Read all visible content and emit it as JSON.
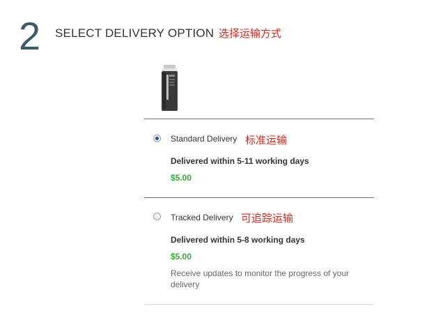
{
  "step": {
    "number": "2",
    "title": "SELECT DELIVERY OPTION",
    "title_annotation": "选择运输方式"
  },
  "product": {
    "icon": "exfoliant-bottle-image"
  },
  "options": [
    {
      "label": "Standard Delivery",
      "annotation": "标准运输",
      "description": "Delivered within 5-11 working days",
      "price": "$5.00",
      "selected": true
    },
    {
      "label": "Tracked Delivery",
      "annotation": "可追踪运输",
      "description": "Delivered within 5-8 working days",
      "price": "$5.00",
      "note": "Receive updates to monitor the progress of your delivery",
      "selected": false
    }
  ],
  "colors": {
    "price": "#3aa53a",
    "annotation": "#d0281d",
    "step_number": "#3f5a6b",
    "divider": "#5c7280"
  }
}
